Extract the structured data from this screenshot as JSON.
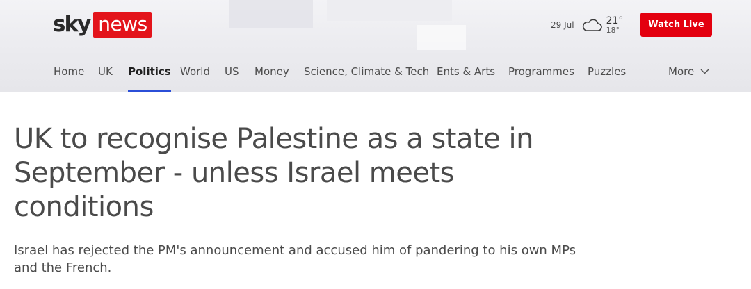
{
  "header": {
    "logo": {
      "sky": "sky",
      "news": "news"
    },
    "weather": {
      "date": "29 Jul",
      "icon": "cloud-icon",
      "high": "21°",
      "low": "18°"
    },
    "watch_live_label": "Watch Live"
  },
  "nav": {
    "items": [
      {
        "label": "Home",
        "active": false
      },
      {
        "label": "UK",
        "active": false
      },
      {
        "label": "Politics",
        "active": true
      },
      {
        "label": "World",
        "active": false
      },
      {
        "label": "US",
        "active": false
      },
      {
        "label": "Money",
        "active": false
      },
      {
        "label": "Science, Climate & Tech",
        "active": false
      },
      {
        "label": "Ents & Arts",
        "active": false
      },
      {
        "label": "Programmes",
        "active": false
      },
      {
        "label": "Puzzles",
        "active": false
      }
    ],
    "more_label": "More",
    "more_icon": "chevron-down-icon"
  },
  "article": {
    "headline": "UK to recognise Palestine as a state in September - unless Israel meets conditions",
    "standfirst": "Israel has rejected the PM's announcement and accused him of pandering to his own MPs and the French."
  },
  "colors": {
    "brand_red": "#e3141b",
    "watch_live_red": "#e3000f",
    "active_underline": "#2b4fd8",
    "masthead_bg": "#ebebef"
  }
}
